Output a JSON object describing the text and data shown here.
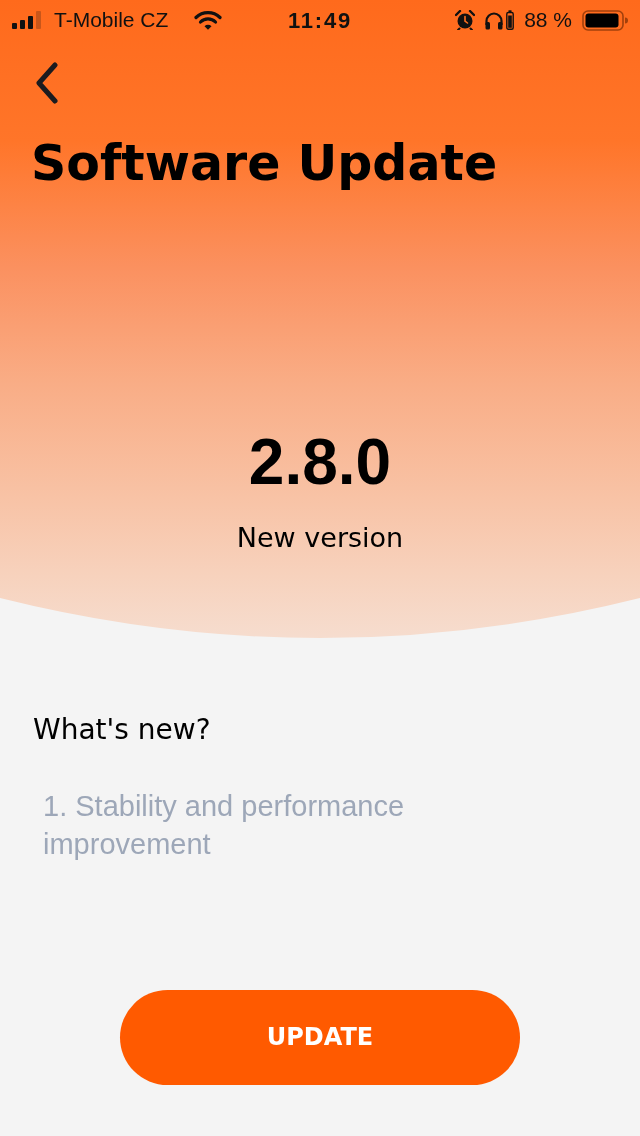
{
  "status_bar": {
    "carrier": "T-Mobile CZ",
    "time": "11:49",
    "battery": "88 %"
  },
  "header": {
    "title": "Software Update"
  },
  "release": {
    "version": "2.8.0",
    "caption": "New version"
  },
  "whats_new": {
    "heading": "What's new?",
    "items": [
      "1. Stability and performance improvement"
    ]
  },
  "action": {
    "label": "UPDATE"
  }
}
